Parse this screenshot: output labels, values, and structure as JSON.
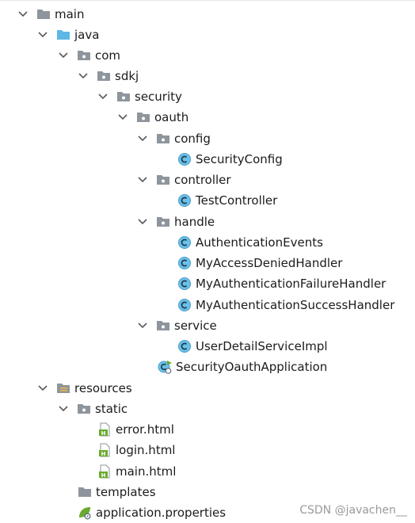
{
  "tree": {
    "main": "main",
    "java": "java",
    "com": "com",
    "sdkj": "sdkj",
    "security": "security",
    "oauth": "oauth",
    "config": "config",
    "security_config": "SecurityConfig",
    "controller": "controller",
    "test_controller": "TestController",
    "handle": "handle",
    "authentication_events": "AuthenticationEvents",
    "my_access_denied_handler": "MyAccessDeniedHandler",
    "my_authentication_failure_handler": "MyAuthenticationFailureHandler",
    "my_authentication_success_handler": "MyAuthenticationSuccessHandler",
    "service": "service",
    "user_detail_service_impl": "UserDetailServiceImpl",
    "security_oauth_application": "SecurityOauthApplication",
    "resources": "resources",
    "static": "static",
    "error_html": "error.html",
    "login_html": "login.html",
    "main_html": "main.html",
    "templates": "templates",
    "application_properties": "application.properties"
  },
  "icons": {
    "expanded": "chevron-down-icon",
    "folder": "folder-icon",
    "source_folder": "source-folder-icon",
    "package": "package-icon",
    "resources_folder": "resources-folder-icon",
    "java_class": "java-class-icon",
    "application_class": "spring-application-icon",
    "html_file": "html-file-icon",
    "properties_file": "properties-file-icon"
  },
  "colors": {
    "folder_gray": "#8e959c",
    "source_folder_blue": "#5fb7e6",
    "class_badge": "#6bc1e6",
    "spring_green": "#6aab2e",
    "watermark": "#9a9a9a"
  },
  "watermark": "CSDN @javachen__"
}
